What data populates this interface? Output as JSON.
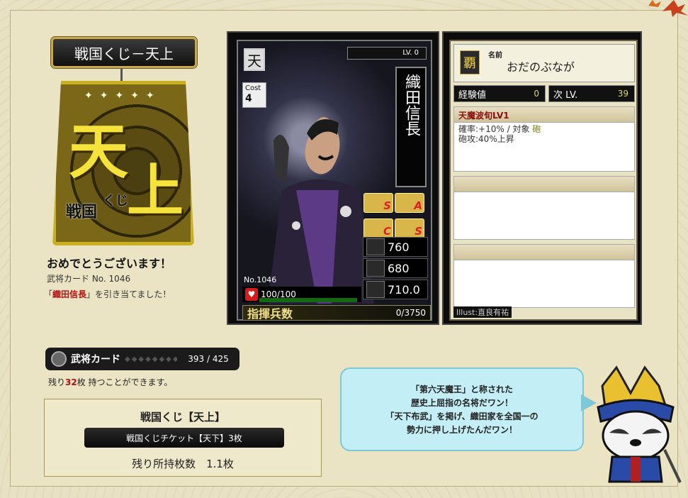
{
  "header": {
    "title": "戦国くじ－天上"
  },
  "ticket": {
    "big1": "天",
    "big2": "上",
    "sub1": "戦国",
    "sub2": "くじ"
  },
  "result": {
    "congrats": "おめでとうございます！",
    "card_no_text": "武将カード No. 1046",
    "hit_prefix": "「",
    "hit_name": "織田信長",
    "hit_suffix": "」を引き当てました！"
  },
  "card_count": {
    "label": "武将カード",
    "value": "393 / 425"
  },
  "remaining": {
    "prefix": "残り",
    "count": "32",
    "suffix": "枚 持つことができます。"
  },
  "lottery_box": {
    "title": "戦国くじ【天上】",
    "ticket_label": "戦国くじチケット【天下】3枚",
    "owned": "残り所持枚数　1.1枚"
  },
  "card": {
    "rarity": "天",
    "cost_label": "Cost",
    "cost": "4",
    "level": "LV. 0",
    "name": "織田信長",
    "skills": [
      {
        "icon": "infantry-icon",
        "rank": "S"
      },
      {
        "icon": "cavalry-icon",
        "rank": "A"
      },
      {
        "icon": "archer-icon",
        "rank": "C"
      },
      {
        "icon": "gun-icon",
        "rank": "S"
      }
    ],
    "stats": {
      "attack": "760",
      "defense": "680",
      "intellect": "710.0"
    },
    "no": "No.1046",
    "hp": "100/100",
    "hp_fraction": 1.0,
    "command_label": "指揮兵数",
    "command_value": "0/3750"
  },
  "info": {
    "stamp": "覇",
    "name_label": "名前",
    "name_value": "おだのぶなが",
    "exp_label": "経験値",
    "exp_value": "0",
    "next_label": "次 LV.",
    "next_value": "39",
    "skill_title": "天魔波旬LV1",
    "skill_line1_a": "確率:+10% / 対象 ",
    "skill_line1_b": "砲",
    "skill_line2": "砲攻:40%上昇",
    "illust": "Illust:直良有祐"
  },
  "speech": {
    "line1": "「第六天魔王」と称された",
    "line2": "歴史上屈指の名将だワン！",
    "line3": "「天下布武」を掲げ、織田家を全国一の",
    "line4": "勢力に押し上げたんだワン！"
  }
}
